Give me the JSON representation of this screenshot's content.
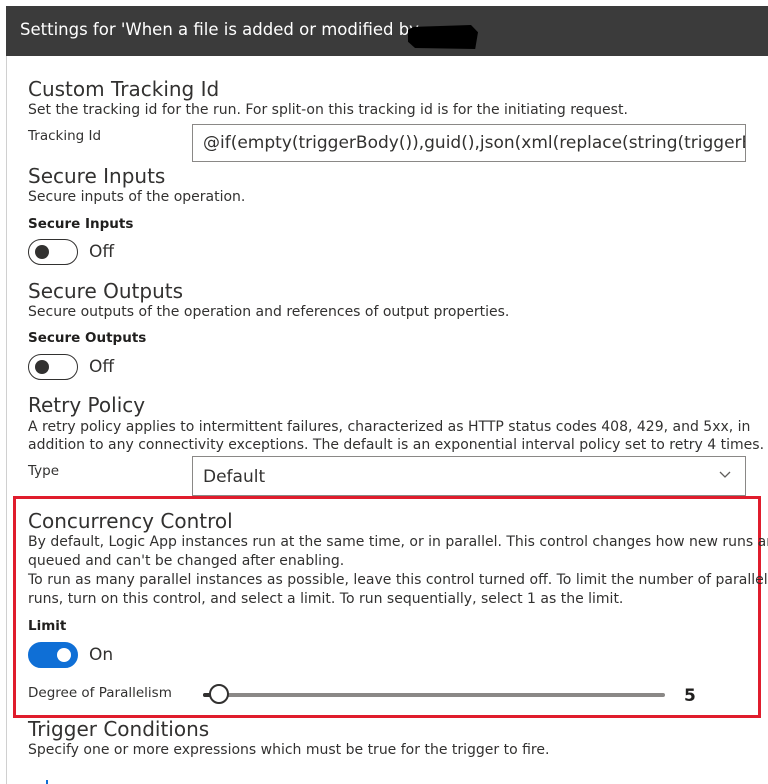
{
  "header": {
    "title": "Settings for 'When a file is added or modified by"
  },
  "tracking": {
    "title": "Custom Tracking Id",
    "description": "Set the tracking id for the run. For split-on this tracking id is for the initiating request.",
    "field_label": "Tracking Id",
    "value": "@if(empty(triggerBody()),guid(),json(xml(replace(string(triggerBody("
  },
  "secure_inputs": {
    "title": "Secure Inputs",
    "description": "Secure inputs of the operation.",
    "toggle_label": "Secure Inputs",
    "state_text": "Off"
  },
  "secure_outputs": {
    "title": "Secure Outputs",
    "description": "Secure outputs of the operation and references of output properties.",
    "toggle_label": "Secure Outputs",
    "state_text": "Off"
  },
  "retry": {
    "title": "Retry Policy",
    "description_line1": "A retry policy applies to intermittent failures, characterized as HTTP status codes 408, 429, and 5xx, in",
    "description_line2": "addition to any connectivity exceptions. The default is an exponential interval policy set to retry 4 times.",
    "type_label": "Type",
    "type_value": "Default"
  },
  "concurrency": {
    "title": "Concurrency Control",
    "desc_line1": "By default, Logic App instances run at the same time, or in parallel. This control changes how new runs are",
    "desc_line2": "queued and can't be changed after enabling.",
    "desc_line3": "To run as many parallel instances as possible, leave this control turned off. To limit the number of parallel",
    "desc_line4": "runs, turn on this control, and select a limit. To run sequentially, select 1 as the limit.",
    "limit_label": "Limit",
    "state_text": "On",
    "parallelism_label": "Degree of Parallelism",
    "parallelism_value": "5",
    "highlight_color": "#e01c2c",
    "toggle_color": "#0f6fd6"
  },
  "trigger_conditions": {
    "title": "Trigger Conditions",
    "description": "Specify one or more expressions which must be true for the trigger to fire."
  },
  "icons": {
    "select": "chevron-down-icon"
  }
}
